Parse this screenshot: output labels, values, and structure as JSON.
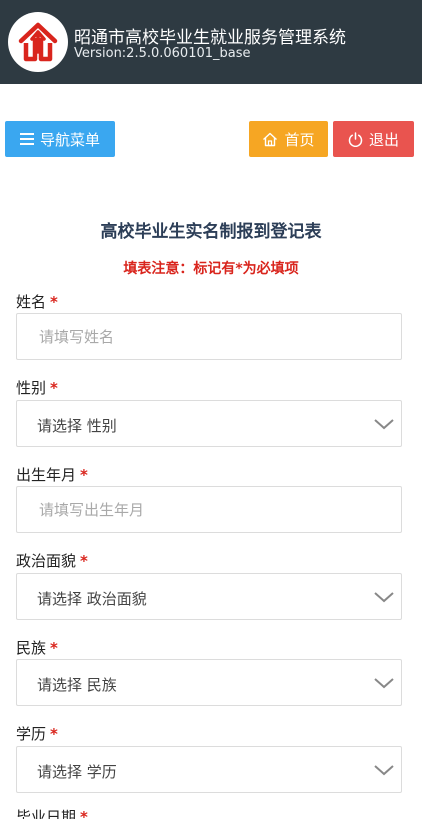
{
  "header": {
    "title": "昭通市高校毕业生就业服务管理系统",
    "version": "Version:2.5.0.060101_base",
    "logo_icon": "house-arrow-logo-icon",
    "bg_color": "#2e3a42",
    "logo_color": "#d9251d"
  },
  "toolbar": {
    "nav_label": "导航菜单",
    "nav_icon": "menu-icon",
    "home_label": "首页",
    "home_icon": "home-icon",
    "exit_label": "退出",
    "exit_icon": "power-icon",
    "colors": {
      "nav": "#3aa7f0",
      "home": "#f6a623",
      "exit": "#e9544f"
    }
  },
  "form": {
    "title": "高校毕业生实名制报到登记表",
    "note": "填表注意：标记有*为必填项",
    "required_mark": "*",
    "fields": [
      {
        "label": "姓名",
        "type": "text",
        "placeholder": "请填写姓名"
      },
      {
        "label": "性别",
        "type": "select",
        "value": "请选择 性别"
      },
      {
        "label": "出生年月",
        "type": "text",
        "placeholder": "请填写出生年月"
      },
      {
        "label": "政治面貌",
        "type": "select",
        "value": "请选择 政治面貌"
      },
      {
        "label": "民族",
        "type": "select",
        "value": "请选择 民族"
      },
      {
        "label": "学历",
        "type": "select",
        "value": "请选择 学历"
      }
    ],
    "next_field_label": "毕业日期"
  }
}
